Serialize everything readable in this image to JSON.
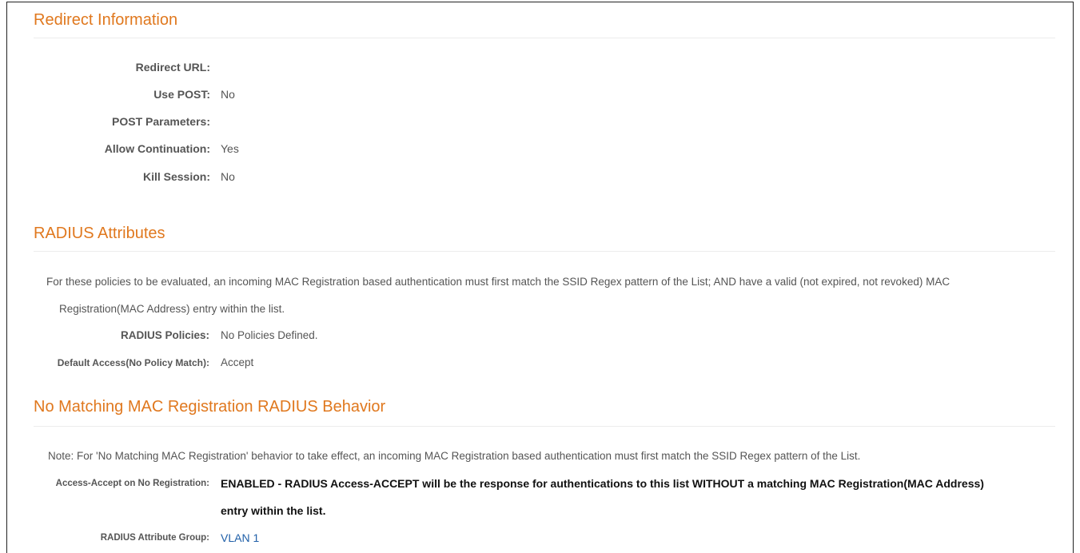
{
  "redirect": {
    "title": "Redirect Information",
    "fields": [
      {
        "label": "Redirect URL:",
        "value": ""
      },
      {
        "label": "Use POST:",
        "value": "No"
      },
      {
        "label": "POST Parameters:",
        "value": ""
      },
      {
        "label": "Allow Continuation:",
        "value": "Yes"
      },
      {
        "label": "Kill Session:",
        "value": "No"
      }
    ]
  },
  "radius": {
    "title": "RADIUS Attributes",
    "note_line1": "For these policies to be evaluated, an incoming MAC Registration based authentication must first match the SSID Regex pattern of the List; AND have a valid (not expired, not revoked) MAC",
    "note_line2": "Registration(MAC Address) entry within the list.",
    "policies_label": "RADIUS Policies:",
    "policies_value": "No Policies Defined.",
    "default_label": "Default Access(No Policy Match):",
    "default_value": "Accept"
  },
  "no_match": {
    "title": "No Matching MAC Registration RADIUS Behavior",
    "note": "Note: For 'No Matching MAC Registration' behavior to take effect, an incoming MAC Registration based authentication must first match the SSID Regex pattern of the List.",
    "accept_label": "Access-Accept on No Registration:",
    "accept_value_line1": "ENABLED - RADIUS Access-ACCEPT will be the response for authentications to this list WITHOUT a matching MAC Registration(MAC Address)",
    "accept_value_line2": "entry within the list.",
    "group_label": "RADIUS Attribute Group:",
    "group_value": "VLAN 1"
  }
}
